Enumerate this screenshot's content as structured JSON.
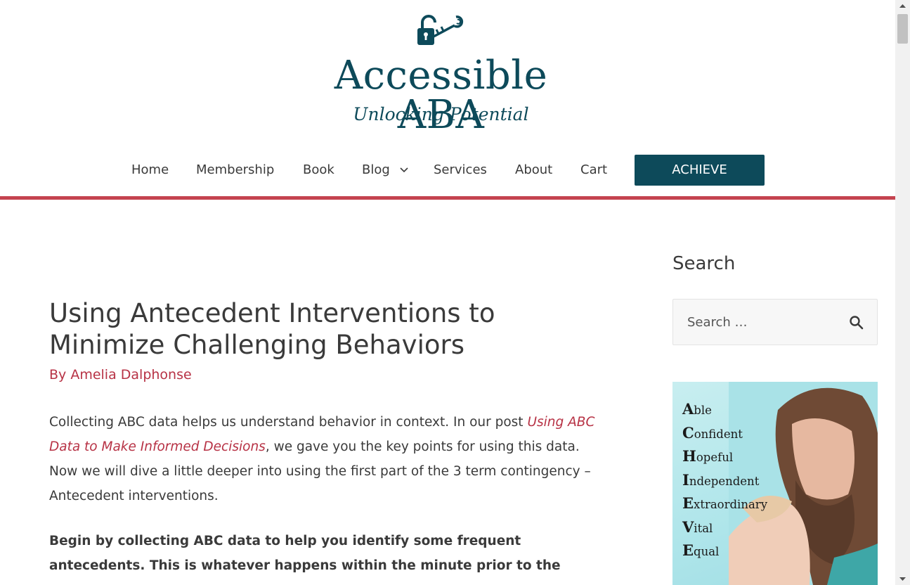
{
  "site": {
    "title": "Accessible ABA",
    "tagline": "Unlocking Potential",
    "brand_color": "#0d4a5a",
    "accent_color": "#c4434f"
  },
  "nav": {
    "items": [
      {
        "label": "Home"
      },
      {
        "label": "Membership"
      },
      {
        "label": "Book"
      },
      {
        "label": "Blog",
        "has_dropdown": true
      },
      {
        "label": "Services"
      },
      {
        "label": "About"
      },
      {
        "label": "Cart"
      }
    ],
    "cta_label": "ACHIEVE"
  },
  "post": {
    "title": "Using Antecedent Interventions to Minimize Challenging Behaviors",
    "byline_prefix": "By ",
    "author": "Amelia Dalphonse",
    "para1_before_link": "Collecting ABC data helps us understand behavior in context.  In our post ",
    "para1_link": "Using ABC Data to Make Informed Decisions",
    "para1_after_link": ", we gave you the key points for using this data. Now we will dive a little deeper into using the first part of the 3 term contingency – Antecedent interventions.",
    "para2": "Begin by collecting ABC data to help you identify some frequent antecedents.  This is whatever happens within the minute prior to the"
  },
  "sidebar": {
    "search_title": "Search",
    "search_placeholder": "Search …",
    "search_icon": "search-icon",
    "promo_words": [
      "Able",
      "Confident",
      "Hopeful",
      "Independent",
      "Extraordinary",
      "Vital",
      "Equal"
    ]
  }
}
